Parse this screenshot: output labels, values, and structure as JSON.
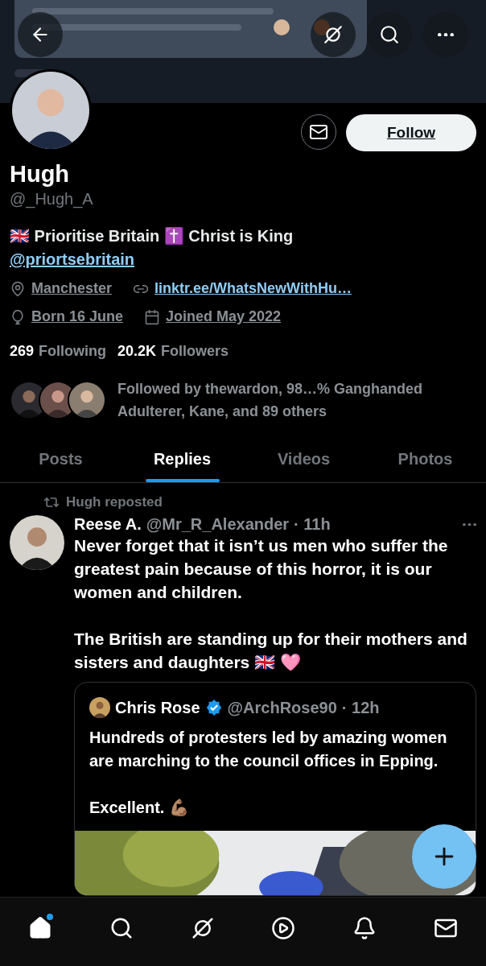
{
  "profile": {
    "name": "Hugh",
    "handle": "@_Hugh_A",
    "bio": "🇬🇧 Prioritise Britain ✝️ Christ is King",
    "bio_link": "@priortsebritain",
    "location": "Manchester",
    "website": "linktr.ee/WhatsNewWithHu…",
    "birthday": "Born 16 June",
    "joined": "Joined May 2022",
    "following_count": "269",
    "following_label": "Following",
    "followers_count": "20.2K",
    "followers_label": "Followers",
    "followed_by": "Followed by thewardon, 98…% Ganghanded Adulterer, Kane, and 89 others",
    "follow_button": "Follow"
  },
  "tabs": [
    {
      "label": "Posts",
      "selected": false
    },
    {
      "label": "Replies",
      "selected": true
    },
    {
      "label": "Videos",
      "selected": false
    },
    {
      "label": "Photos",
      "selected": false
    }
  ],
  "post": {
    "repost_label": "Hugh reposted",
    "author": "Reese A.",
    "handle": "@Mr_R_Alexander",
    "time": "· 11h",
    "paragraphs": [
      "Never forget that it isn’t us men who suffer the greatest pain because of this horror, it is our women and children.",
      "The British are standing up for their mothers and sisters and daughters 🇬🇧 🩷"
    ],
    "quote": {
      "author": "Chris Rose",
      "handle": "@ArchRose90",
      "time": "· 12h",
      "paragraphs": [
        "Hundreds of protesters led by amazing women are marching to the council offices in Epping.",
        "Excellent. 💪🏽"
      ]
    }
  },
  "nav": [
    {
      "kind": "home",
      "selected": true,
      "badge": true
    },
    {
      "kind": "search",
      "selected": false,
      "badge": false
    },
    {
      "kind": "grok",
      "selected": false,
      "badge": false
    },
    {
      "kind": "video",
      "selected": false,
      "badge": false
    },
    {
      "kind": "notifications",
      "selected": false,
      "badge": false
    },
    {
      "kind": "messages",
      "selected": false,
      "badge": false
    }
  ]
}
